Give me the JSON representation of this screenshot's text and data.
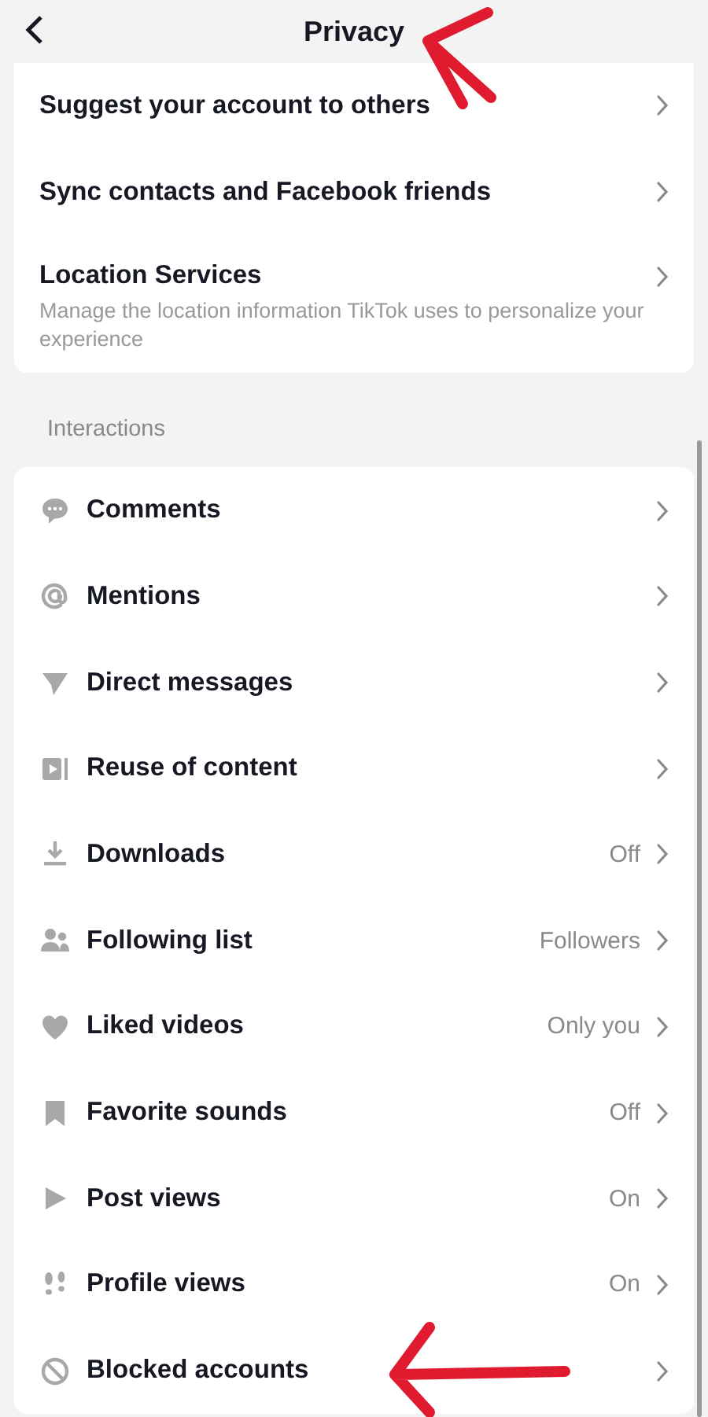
{
  "header": {
    "title": "Privacy"
  },
  "top_items": [
    {
      "label": "Suggest your account to others"
    },
    {
      "label": "Sync contacts and Facebook friends"
    },
    {
      "label": "Location Services",
      "description": "Manage the location information TikTok uses to personalize your experience"
    }
  ],
  "section": {
    "title": "Interactions",
    "items": [
      {
        "kind": "comment",
        "label": "Comments"
      },
      {
        "kind": "at",
        "label": "Mentions"
      },
      {
        "kind": "send",
        "label": "Direct messages"
      },
      {
        "kind": "reuse",
        "label": "Reuse of content"
      },
      {
        "kind": "download",
        "label": "Downloads",
        "value": "Off"
      },
      {
        "kind": "people",
        "label": "Following list",
        "value": "Followers"
      },
      {
        "kind": "heart",
        "label": "Liked videos",
        "value": "Only you"
      },
      {
        "kind": "bookmark",
        "label": "Favorite sounds",
        "value": "Off"
      },
      {
        "kind": "play",
        "label": "Post views",
        "value": "On"
      },
      {
        "kind": "footprints",
        "label": "Profile views",
        "value": "On"
      },
      {
        "kind": "block",
        "label": "Blocked accounts"
      }
    ]
  }
}
